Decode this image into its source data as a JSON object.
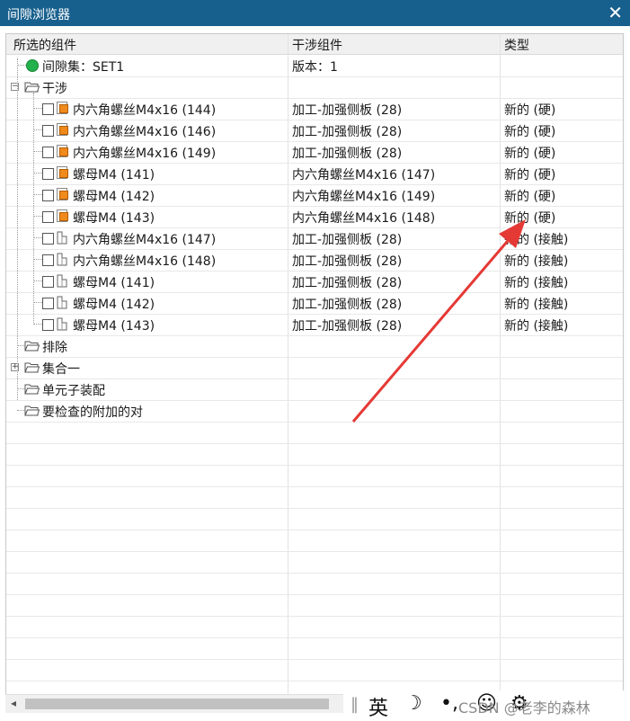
{
  "window": {
    "title": "间隙浏览器",
    "close_glyph": "✕"
  },
  "columns": [
    "所选的组件",
    "干涉组件",
    "类型"
  ],
  "rows": [
    {
      "kind": "set",
      "c1": "间隙集：SET1",
      "c2": "版本：1",
      "c3": ""
    },
    {
      "kind": "folder-open",
      "c1": "干涉",
      "c2": "",
      "c3": ""
    },
    {
      "kind": "hard",
      "c1": "内六角螺丝M4x16 (144)",
      "c2": "加工-加强侧板 (28)",
      "c3": "新的 (硬)"
    },
    {
      "kind": "hard",
      "c1": "内六角螺丝M4x16 (146)",
      "c2": "加工-加强侧板 (28)",
      "c3": "新的 (硬)"
    },
    {
      "kind": "hard",
      "c1": "内六角螺丝M4x16 (149)",
      "c2": "加工-加强侧板 (28)",
      "c3": "新的 (硬)"
    },
    {
      "kind": "hard",
      "c1": "螺母M4 (141)",
      "c2": "内六角螺丝M4x16 (147)",
      "c3": "新的 (硬)"
    },
    {
      "kind": "hard",
      "c1": "螺母M4 (142)",
      "c2": "内六角螺丝M4x16 (149)",
      "c3": "新的 (硬)"
    },
    {
      "kind": "hard",
      "c1": "螺母M4 (143)",
      "c2": "内六角螺丝M4x16 (148)",
      "c3": "新的 (硬)"
    },
    {
      "kind": "touch",
      "c1": "内六角螺丝M4x16 (147)",
      "c2": "加工-加强侧板 (28)",
      "c3": "新的 (接触)"
    },
    {
      "kind": "touch",
      "c1": "内六角螺丝M4x16 (148)",
      "c2": "加工-加强侧板 (28)",
      "c3": "新的 (接触)"
    },
    {
      "kind": "touch",
      "c1": "螺母M4 (141)",
      "c2": "加工-加强侧板 (28)",
      "c3": "新的 (接触)"
    },
    {
      "kind": "touch",
      "c1": "螺母M4 (142)",
      "c2": "加工-加强侧板 (28)",
      "c3": "新的 (接触)"
    },
    {
      "kind": "touch",
      "c1": "螺母M4 (143)",
      "c2": "加工-加强侧板 (28)",
      "c3": "新的 (接触)"
    },
    {
      "kind": "folder",
      "c1": "排除",
      "c2": "",
      "c3": ""
    },
    {
      "kind": "folder-plus",
      "c1": "集合一",
      "c2": "",
      "c3": ""
    },
    {
      "kind": "folder",
      "c1": "单元子装配",
      "c2": "",
      "c3": ""
    },
    {
      "kind": "folder",
      "c1": "要检查的附加的对",
      "c2": "",
      "c3": ""
    }
  ],
  "ime_bar": {
    "lang": "英",
    "moon": "☽",
    "punct": "•,",
    "emoji": "☺",
    "gear": "⚙",
    "watermark": "CSDN @老李的森林"
  },
  "colors": {
    "title_bar": "#17608e",
    "hard_icon": "#f08a1c",
    "set_dot": "#22b14c",
    "arrow": "#e53935"
  }
}
